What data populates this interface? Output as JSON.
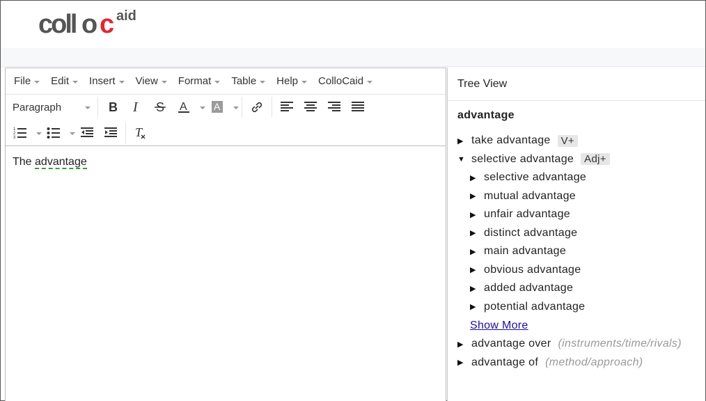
{
  "header": {
    "logo_text": "colloc",
    "logo_sup": "aid"
  },
  "menubar": [
    {
      "label": "File"
    },
    {
      "label": "Edit"
    },
    {
      "label": "Insert"
    },
    {
      "label": "View"
    },
    {
      "label": "Format"
    },
    {
      "label": "Table"
    },
    {
      "label": "Help"
    },
    {
      "label": "ColloCaid"
    }
  ],
  "toolbar": {
    "block_format": "Paragraph",
    "bold_icon": "bold-icon",
    "italic_icon": "italic-icon",
    "strike_icon": "strikethrough-icon",
    "text_color_icon": "text-color-icon",
    "bg_color_icon": "background-color-icon",
    "link_icon": "link-icon",
    "colors": {
      "text_color": "#333333",
      "bg_swatch": "#9a9a9a"
    }
  },
  "editor": {
    "prefix": "The ",
    "word": "advantage"
  },
  "tree": {
    "title": "Tree View",
    "root": "advantage",
    "nodes": [
      {
        "label": "take advantage",
        "tag": "V+",
        "expanded": false
      },
      {
        "label": "selective advantage",
        "tag": "Adj+",
        "expanded": true,
        "children": [
          {
            "label": "selective advantage"
          },
          {
            "label": "mutual advantage"
          },
          {
            "label": "unfair advantage"
          },
          {
            "label": "distinct advantage"
          },
          {
            "label": "main advantage"
          },
          {
            "label": "obvious advantage"
          },
          {
            "label": "added advantage"
          },
          {
            "label": "potential advantage"
          }
        ],
        "show_more": "Show More"
      },
      {
        "label": "advantage over",
        "hint": "(instruments/time/rivals)",
        "expanded": false
      },
      {
        "label": "advantage of",
        "hint": "(method/approach)",
        "expanded": false
      }
    ]
  },
  "accent": {
    "link": "#1a0dab",
    "logo_red": "#e8232f",
    "logo_gray": "#555555"
  }
}
